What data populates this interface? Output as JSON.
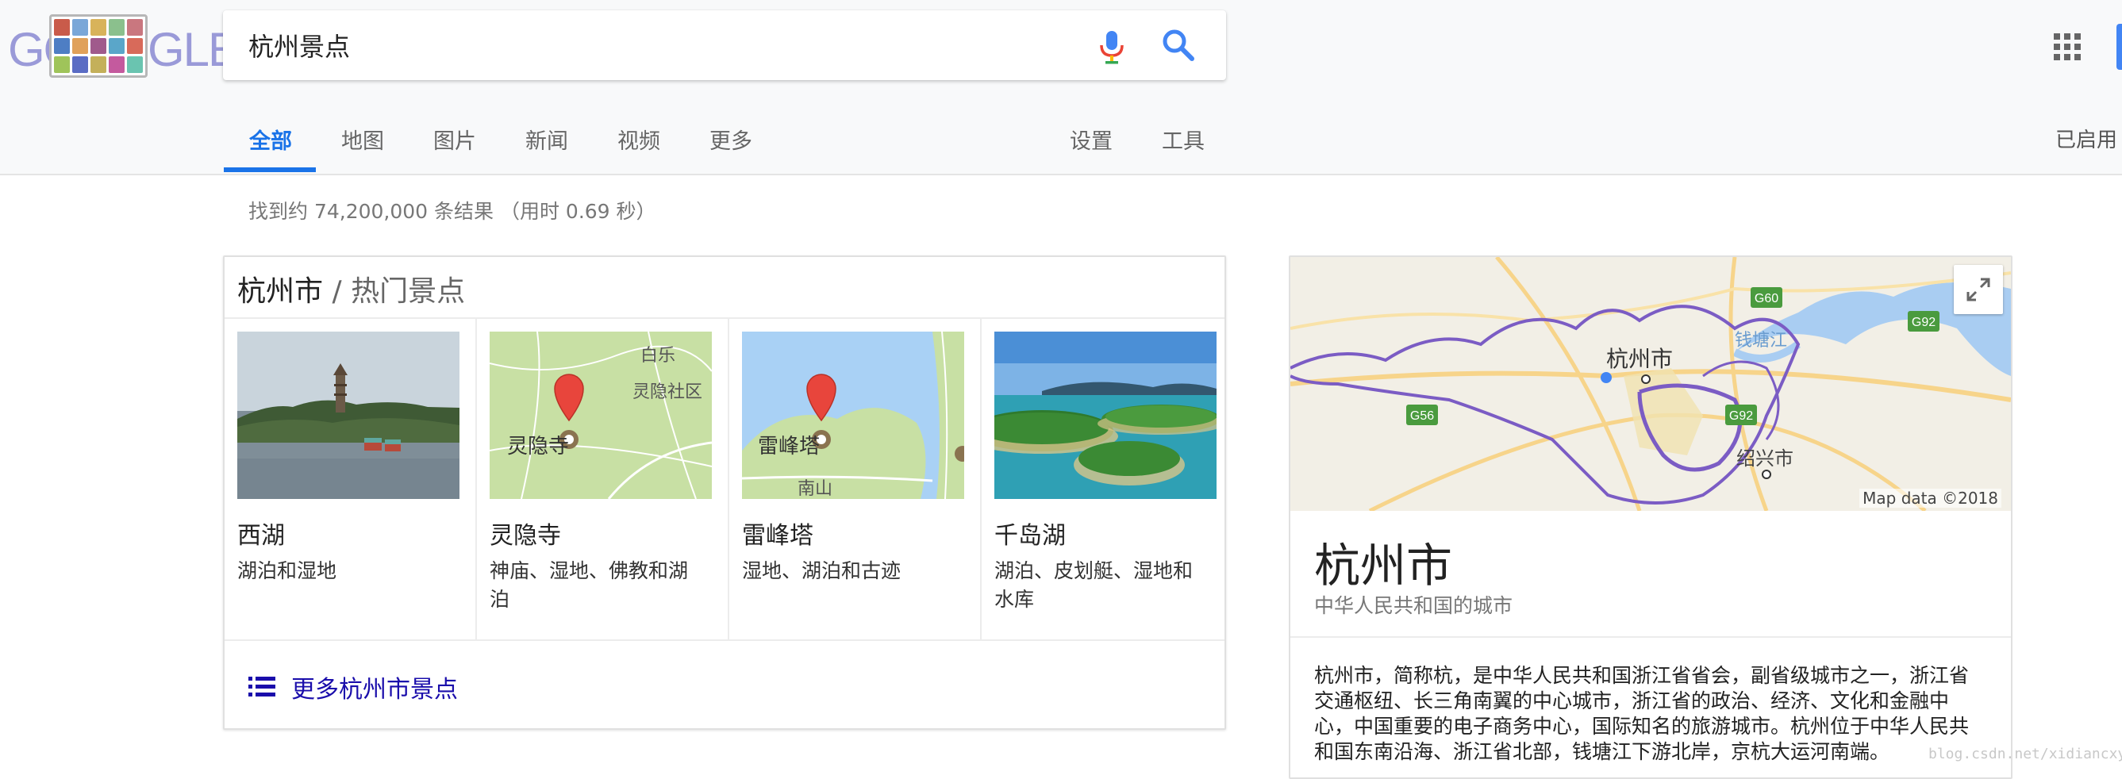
{
  "search": {
    "query": "杭州景点"
  },
  "tabs": [
    "全部",
    "地图",
    "图片",
    "新闻",
    "视频",
    "更多"
  ],
  "tools": {
    "settings": "设置",
    "tools": "工具"
  },
  "right_status": "已启用",
  "result_stats": "找到约 74,200,000 条结果 （用时 0.69 秒）",
  "card": {
    "title_city": "杭州市",
    "title_sep": "/",
    "title_sub": "热门景点",
    "attractions": [
      {
        "name": "西湖",
        "category": "湖泊和湿地"
      },
      {
        "name": "灵隐寺",
        "category": "神庙、湿地、佛教和湖泊",
        "map_label": "灵隐寺",
        "map_extra": [
          "灵隐社区",
          "白乐"
        ]
      },
      {
        "name": "雷峰塔",
        "category": "湿地、湖泊和古迹",
        "map_label": "雷峰塔",
        "map_extra": [
          "南山"
        ]
      },
      {
        "name": "千岛湖",
        "category": "湖泊、皮划艇、湿地和水库"
      }
    ],
    "more_link": "更多杭州市景点"
  },
  "knowledge_panel": {
    "title": "杭州市",
    "subtitle": "中华人民共和国的城市",
    "description": "杭州市，简称杭，是中华人民共和国浙江省省会，副省级城市之一，浙江省交通枢纽、长三角南翼的中心城市，浙江省的政治、经济、文化和金融中心，中国重要的电子商务中心，国际知名的旅游城市。杭州位于中华人民共和国东南沿海、浙江省北部，钱塘江下游北岸，京杭大运河南端。",
    "map": {
      "labels": {
        "city": "杭州市",
        "city2": "绍兴市",
        "river": "钱塘江"
      },
      "shields": [
        "G60",
        "G92",
        "G56",
        "G92"
      ],
      "attribution": "Map data ©2018"
    }
  },
  "watermark": "blog.csdn.net/xidiancxy",
  "colors": {
    "accent": "#1a73e8",
    "link": "#1a0dab",
    "pin": "#e8453c",
    "boundary": "#7b5cc4"
  }
}
